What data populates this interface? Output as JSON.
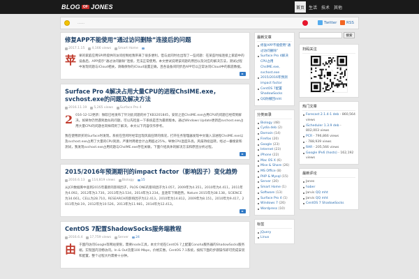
{
  "site": {
    "logo_left": "BLOG",
    "logo_mid": "OF",
    "logo_right": "JONES"
  },
  "nav": [
    "首页",
    "生活",
    "技术",
    "其他"
  ],
  "notice": {
    "text": "……"
  },
  "social": {
    "twitter": "Twitter",
    "rss": "RSS"
  },
  "colors": {
    "topbar": "#1a1a1a",
    "title_blue": "#1c3f66",
    "link_blue": "#2a6db0",
    "dropcap_red": "#c0392b",
    "weibo_red": "#e6162d"
  },
  "posts": [
    {
      "title": "修复APP不能使用“通过访问删除”连接后的问题",
      "date": "2017.1.15",
      "views": "4,166 views",
      "category": "Smart Home",
      "dropcap": "苹",
      "excerpt": "果的家庭应用SPI所提供的访问控制给我带来了很多便利，但与此同时也出现了一些问题：在某些时候连接上家庭中的设备后，APP提示“通过访问删除”连接，无法正常使用。本文尝试说明该问题的原因以及对应的解决方法，测试过程中发现问题与iCloud相关，请确保你的iCloud设置正确，且各设备间同步后APP可以正常访问iCloud中的家庭数据。",
      "para2": ""
    },
    {
      "title": "Surface Pro 4解决占用大量CPU的进程ChsIME.exe，svchost.exe的问题及解决方法",
      "date": "2016.11.19",
      "views": "5,265 views",
      "category": "Surface Pro 4",
      "dropcap": "2",
      "excerpt": "016-12-12更新：微软已经发布了针对此问题的补丁KB3201845，安装之后ChsIME.exe占用CPU的问题已经得到解决。如果你仍然遇到类似的问题，可以先检查一下系统是否为最新版本。通过Windows Update更新后svchost.exe占用大量CPU的问题也同样得到了解决，本文以下内容仅作参考。",
      "para2": "我在使用新买的Surface时发现，系统在空闲时经常出现风扇狂转的情况，打开任务管理器发现中文输入法进程ChsIME.exe以及svchost.exe占用了大量的CPU资源，严重时两者合计占用超过25%，导致CPU温度升高，风扇持续运转。经过一番搜索和测试，我发现svchost.exe占用问题与ChsIME.exe存在关联，下面介绍具体的解决方法和原因分析过程。"
    },
    {
      "title": "2015/2016年预测期刊的impact factor（影响因子）变化趋势",
      "date": "2016.6.13",
      "views": "114,819 views",
      "category": "Biology",
      "comments": "15",
      "dropcap": "",
      "excerpt": "从JCR数据库中查到2015年最新的影响因子，PLOS ONE的影响因子为3.057，2009年为4.351，2010年为4.411，2011年为4.092，2012年为3.730，2013年为3.534，2014年为3.234，呈逐年下降趋势。Nature 2015年为38.138，SCIENCE为34.661，CELL为28.710，RESEARCH的影响因子为12.413，2010年为14.812，2009年为8.151，2010年为9.417，2011年为8.19，2012年为10.526，2013年为11.981，2014年为12.413。",
      "para2": ""
    },
    {
      "title": "CentOS 7配置ShadowSocks服务端教程",
      "date": "2016.6.4",
      "views": "17,759 views",
      "category": "Server",
      "comments": "24",
      "dropcap": "由",
      "excerpt": "于国内访问Google等网站受限，需要inode工具，本文介绍在CentOS 7上配置Conoha服务器的ShadowSocks服务端，实现国内流畅访问。In & Out流量100 Mbps，价格实惠。CentOS 7.1系统，按照下面的步骤操作即可完成安装和配置，整个过程大约需要十分钟。",
      "para2": ""
    }
  ],
  "mid_sidebar": {
    "recent_title": "最新文章",
    "recent": [
      "修复APP不能使用“通过访问删除”",
      "Surface Pro 4解决CPU占用ChsIME.exe, svchost.exe",
      "2015/2016年预测impact factor",
      "CentOS 7配置ShadowSocks",
      "QQ防撤回mht"
    ],
    "cats_title": "分类目录",
    "cats": [
      {
        "name": "Biology",
        "count": "(48)"
      },
      {
        "name": "Cydia deb",
        "count": "(2)"
      },
      {
        "name": "Domain",
        "count": "(14)"
      },
      {
        "name": "Firefox",
        "count": "(20)"
      },
      {
        "name": "Google",
        "count": "(23)"
      },
      {
        "name": "Internet",
        "count": "(23)"
      },
      {
        "name": "iPhone",
        "count": "(22)"
      },
      {
        "name": "Mac OS X",
        "count": "(6)"
      },
      {
        "name": "Mise & Share",
        "count": "(26)"
      },
      {
        "name": "MS Office",
        "count": "(8)"
      },
      {
        "name": "PHP & Mysql",
        "count": "(15)"
      },
      {
        "name": "Server",
        "count": "(20)"
      },
      {
        "name": "Smart Home",
        "count": "(1)"
      },
      {
        "name": "Software",
        "count": "(13)"
      },
      {
        "name": "Surface Pro 4",
        "count": "(1)"
      },
      {
        "name": "Windows 7",
        "count": "(26)"
      },
      {
        "name": "Wordpress",
        "count": "(10)"
      }
    ],
    "tags_title": "标签",
    "tags": [
      "jQuery",
      "Linux"
    ]
  },
  "right_sidebar": {
    "search_placeholder": "",
    "search_button": "搜索",
    "qr_title": "扫码关注",
    "popular_title": "热门文章",
    "popular": [
      {
        "title": "Forecast 2.1.4-1 deb",
        "views": "860,564 views"
      },
      {
        "title": "iScheduler 1.3.9 deb",
        "views": "802,003 views"
      },
      {
        "title": "PCR",
        "views": "796,866 views"
      },
      {
        "title": "",
        "views": "788,939 views"
      },
      {
        "title": "RAR",
        "views": "205,566 views"
      },
      {
        "title": "Google IPv6 (hosts)",
        "views": "162,192 views"
      }
    ],
    "comments_title": "最新评论",
    "comments": [
      {
        "author": "Jones",
        "text": ""
      },
      {
        "author": "",
        "text": "haber"
      },
      {
        "author": "Jarvis",
        "text": "QQ mht"
      },
      {
        "author": "Jarvis",
        "text": "QQ mht"
      },
      {
        "author": "",
        "text": "CentOS 7 ShadowSocks"
      }
    ]
  }
}
